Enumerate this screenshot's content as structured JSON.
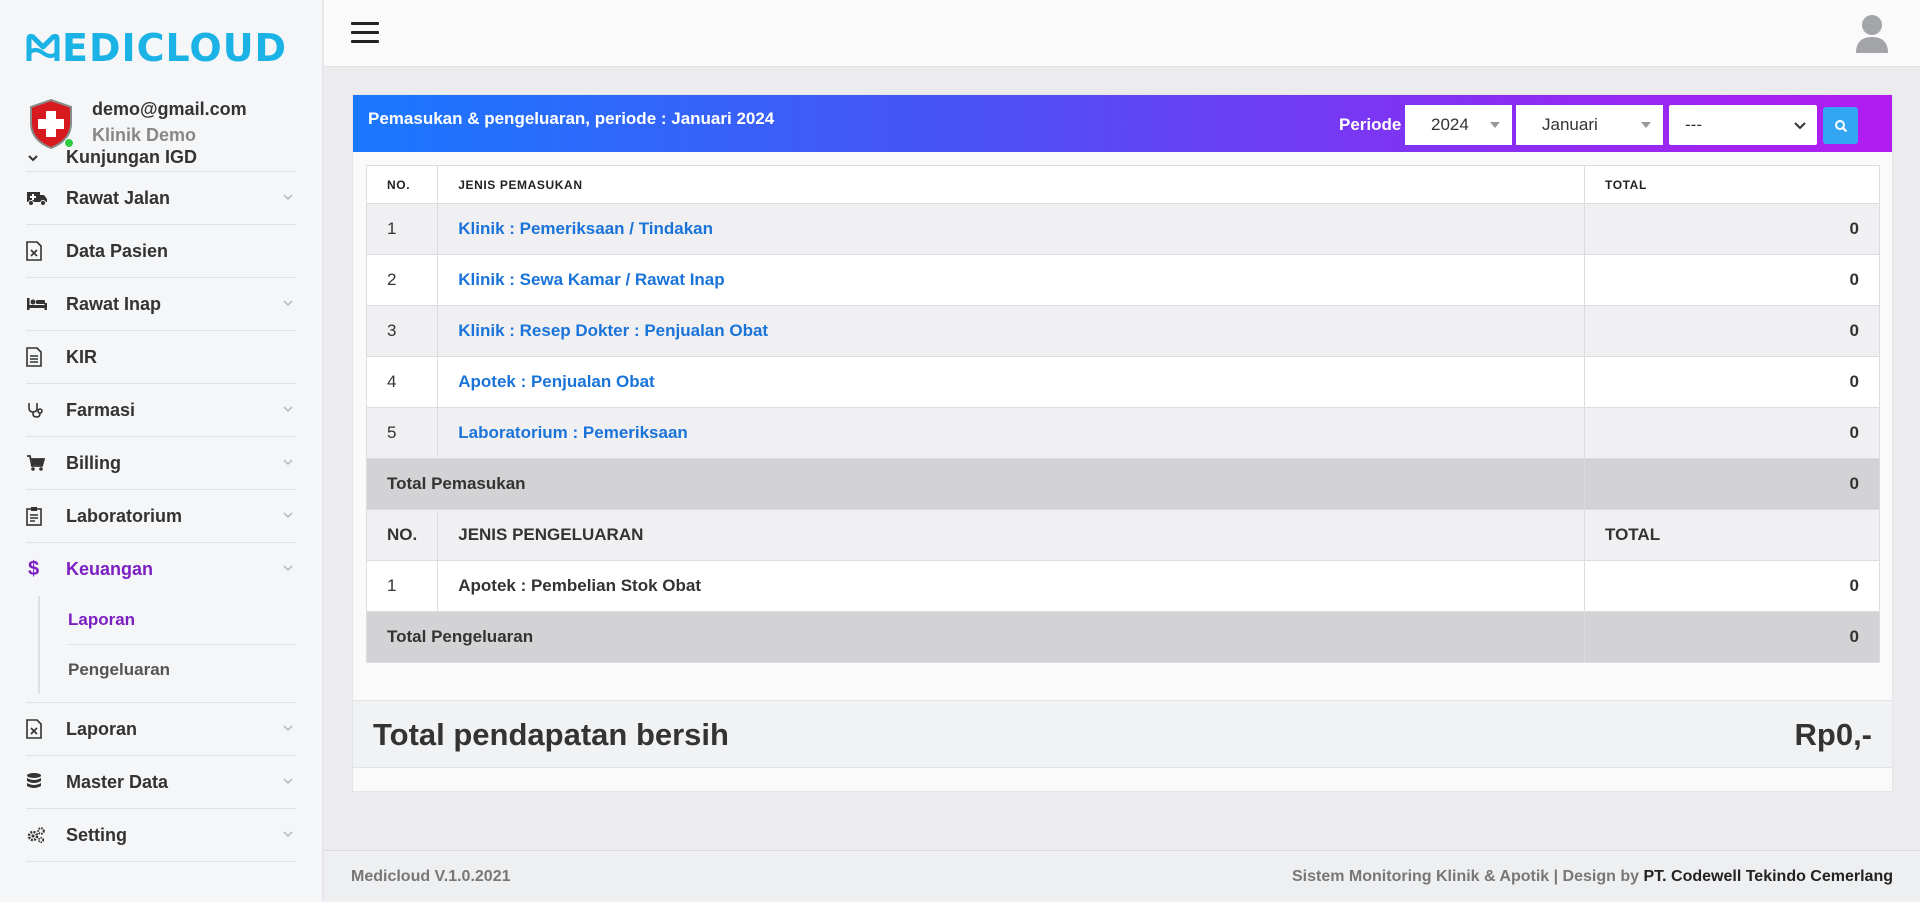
{
  "brand": {
    "name": "MEDICLOUD",
    "color": "#1bb3e6"
  },
  "user": {
    "email": "demo@gmail.com",
    "clinic": "Klinik Demo"
  },
  "sidebar": {
    "partial_item": "Kunjungan IGD",
    "items_top": [
      {
        "label": "Rawat Jalan",
        "icon": "ambulance-icon",
        "has_children": true
      },
      {
        "label": "Data Pasien",
        "icon": "file-excel-icon",
        "has_children": false
      },
      {
        "label": "Rawat Inap",
        "icon": "bed-icon",
        "has_children": true
      },
      {
        "label": "KIR",
        "icon": "document-icon",
        "has_children": false
      },
      {
        "label": "Farmasi",
        "icon": "stethoscope-icon",
        "has_children": true
      },
      {
        "label": "Billing",
        "icon": "cart-icon",
        "has_children": true
      },
      {
        "label": "Laboratorium",
        "icon": "clipboard-icon",
        "has_children": true
      }
    ],
    "active_item": {
      "label": "Keuangan",
      "icon": "dollar-icon"
    },
    "submenu": [
      {
        "label": "Laporan",
        "active": true
      },
      {
        "label": "Pengeluaran",
        "active": false
      }
    ],
    "items_bottom": [
      {
        "label": "Laporan",
        "icon": "file-excel-icon"
      },
      {
        "label": "Master Data",
        "icon": "database-icon"
      },
      {
        "label": "Setting",
        "icon": "gears-icon"
      }
    ]
  },
  "header": {
    "title": "Pemasukan & pengeluaran, periode : Januari 2024",
    "periode_label": "Periode",
    "year": "2024",
    "month": "Januari",
    "extra_select": "---",
    "gradient_start": "#1a78ff",
    "gradient_end": "#b21cf0"
  },
  "table": {
    "head": {
      "no": "NO.",
      "jenis": "JENIS PEMASUKAN",
      "total": "TOTAL"
    },
    "pemasukan": [
      {
        "no": "1",
        "label": "Klinik : Pemeriksaan / Tindakan",
        "total": "0"
      },
      {
        "no": "2",
        "label": "Klinik : Sewa Kamar / Rawat Inap",
        "total": "0"
      },
      {
        "no": "3",
        "label": "Klinik : Resep Dokter : Penjualan Obat",
        "total": "0"
      },
      {
        "no": "4",
        "label": "Apotek : Penjualan Obat",
        "total": "0"
      },
      {
        "no": "5",
        "label": "Laboratorium : Pemeriksaan",
        "total": "0"
      }
    ],
    "total_pemasukan": {
      "label": "Total Pemasukan",
      "value": "0"
    },
    "subhead": {
      "no": "NO.",
      "jenis": "JENIS PENGELUARAN",
      "total": "TOTAL"
    },
    "pengeluaran": [
      {
        "no": "1",
        "label": "Apotek : Pembelian Stok Obat",
        "total": "0"
      }
    ],
    "total_pengeluaran": {
      "label": "Total Pengeluaran",
      "value": "0"
    }
  },
  "net": {
    "label": "Total pendapatan bersih",
    "value": "Rp0,-"
  },
  "footer": {
    "version": "Medicloud V.1.0.2021",
    "credit": "Sistem Monitoring Klinik & Apotik | Design by ",
    "company": "PT. Codewell Tekindo Cemerlang"
  }
}
